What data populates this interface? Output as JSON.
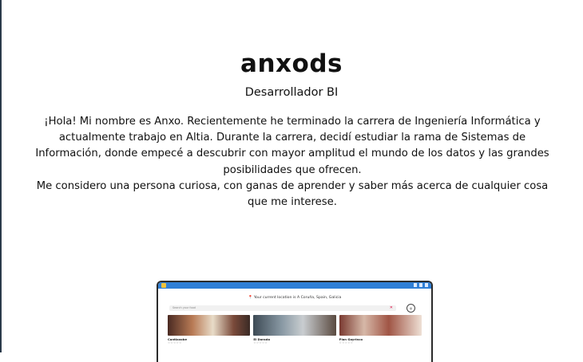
{
  "profile": {
    "name": "anxods",
    "role": "Desarrollador BI",
    "bio_paragraph_1": "¡Hola! Mi nombre es Anxo. Recientemente he terminado la carrera de Ingeniería Informática y actualmente trabajo en Altia. Durante la carrera, decidí estudiar la rama de Sistemas de Información, donde empecé a descubrir con mayor amplitud el mundo de los datos y las grandes posibilidades que ofrecen.",
    "bio_paragraph_2": "Me considero una persona curiosa, con ganas de aprender y saber más acerca de cualquier cosa que me interese."
  },
  "preview": {
    "location_text": "Your current location is A Coruña, Spain, Galicia",
    "search_placeholder": "Search your food",
    "cards": [
      {
        "name": "Cantiaxobe",
        "rating": "☆☆☆☆☆"
      },
      {
        "name": "El Dorado",
        "rating": "☆☆☆☆☆"
      },
      {
        "name": "Plan Gayrinco",
        "rating": "☆☆☆☆☆"
      }
    ],
    "colors": {
      "bar": "#2f7fd6",
      "accent": "#d22b3a"
    }
  }
}
